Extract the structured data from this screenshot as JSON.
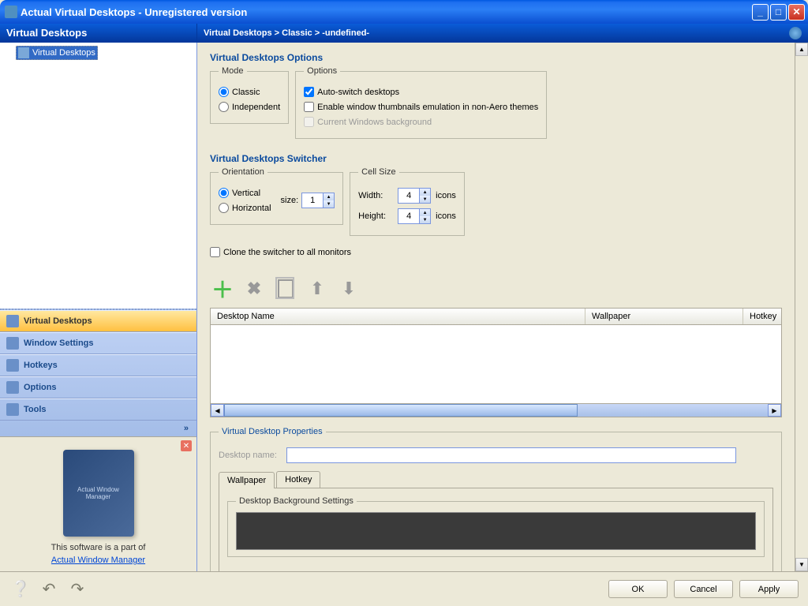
{
  "titlebar": {
    "text": "Actual Virtual Desktops - Unregistered version"
  },
  "header": {
    "left": "Virtual Desktops",
    "breadcrumb": "Virtual Desktops > Classic > -undefined-"
  },
  "tree": {
    "root": "Virtual Desktops"
  },
  "nav": {
    "items": [
      {
        "label": "Virtual Desktops",
        "selected": true
      },
      {
        "label": "Window Settings"
      },
      {
        "label": "Hotkeys"
      },
      {
        "label": "Options"
      },
      {
        "label": "Tools"
      }
    ],
    "expand": "»"
  },
  "promo": {
    "box_text": "Actual Window Manager",
    "line": "This software is a part of",
    "link": "Actual Window Manager"
  },
  "options": {
    "section_title": "Virtual Desktops Options",
    "mode_legend": "Mode",
    "mode_classic": "Classic",
    "mode_independent": "Independent",
    "opts_legend": "Options",
    "auto_switch": "Auto-switch desktops",
    "thumbs": "Enable window thumbnails emulation in non-Aero themes",
    "current_bg": "Current Windows background"
  },
  "switcher": {
    "section_title": "Virtual Desktops Switcher",
    "orient_legend": "Orientation",
    "vertical": "Vertical",
    "horizontal": "Horizontal",
    "size_label": "size:",
    "size_value": "1",
    "cell_legend": "Cell Size",
    "width_label": "Width:",
    "width_value": "4",
    "height_label": "Height:",
    "height_value": "4",
    "icons": "icons",
    "clone": "Clone the switcher to all monitors"
  },
  "table": {
    "col_name": "Desktop Name",
    "col_wall": "Wallpaper",
    "col_hotkey": "Hotkey"
  },
  "props": {
    "legend": "Virtual Desktop Properties",
    "name_label": "Desktop name:",
    "name_value": "",
    "tab_wallpaper": "Wallpaper",
    "tab_hotkey": "Hotkey",
    "bg_legend": "Desktop Background Settings"
  },
  "footer": {
    "ok": "OK",
    "cancel": "Cancel",
    "apply": "Apply"
  }
}
